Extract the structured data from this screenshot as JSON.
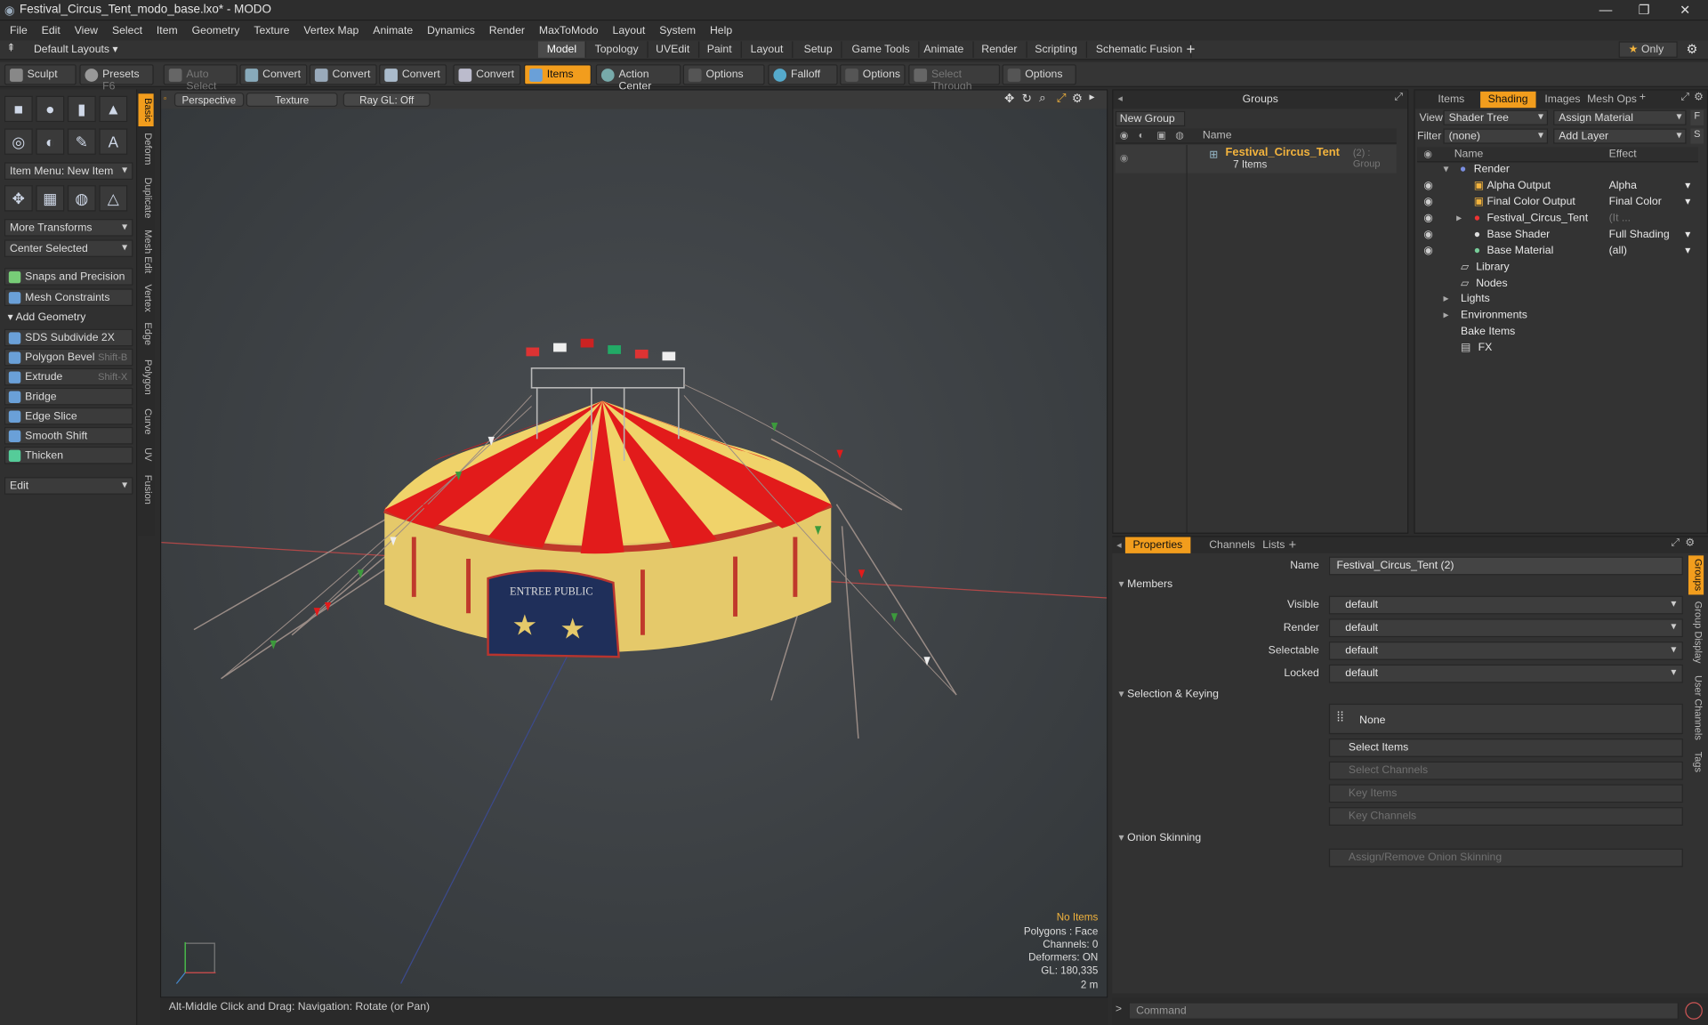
{
  "window": {
    "title": "Festival_Circus_Tent_modo_base.lxo* - MODO"
  },
  "menu": [
    "File",
    "Edit",
    "View",
    "Select",
    "Item",
    "Geometry",
    "Texture",
    "Vertex Map",
    "Animate",
    "Dynamics",
    "Render",
    "MaxToModo",
    "Layout",
    "System",
    "Help"
  ],
  "layouts": {
    "default": "Default Layouts",
    "tabs": [
      "Model",
      "Topology",
      "UVEdit",
      "Paint",
      "Layout",
      "Setup",
      "Game Tools",
      "Animate",
      "Render",
      "Scripting",
      "Schematic Fusion"
    ],
    "active": "Model",
    "only": "Only"
  },
  "toolbar": {
    "sculpt": "Sculpt",
    "presets": "Presets",
    "presets_key": "F6",
    "auto_select": "Auto Select",
    "convert": "Convert",
    "items": "Items",
    "action_center": "Action Center",
    "options": "Options",
    "falloff": "Falloff",
    "select_through": "Select Through"
  },
  "left": {
    "item_menu": "Item Menu: New Item",
    "more_transforms": "More Transforms",
    "center_selected": "Center Selected",
    "snaps": "Snaps and Precision",
    "mesh_constraints": "Mesh Constraints",
    "add_geometry": "Add Geometry",
    "tools": [
      {
        "label": "SDS Subdivide 2X",
        "key": ""
      },
      {
        "label": "Polygon Bevel",
        "key": "Shift-B"
      },
      {
        "label": "Extrude",
        "key": "Shift-X"
      },
      {
        "label": "Bridge",
        "key": ""
      },
      {
        "label": "Edge Slice",
        "key": ""
      },
      {
        "label": "Smooth Shift",
        "key": ""
      },
      {
        "label": "Thicken",
        "key": ""
      }
    ],
    "edit": "Edit",
    "vtabs": [
      "Basic",
      "Deform",
      "Duplicate",
      "Mesh Edit",
      "Vertex",
      "Edge",
      "Polygon",
      "Curve",
      "UV",
      "Fusion"
    ]
  },
  "viewport": {
    "perspective": "Perspective",
    "texture": "Texture",
    "raygl": "Ray GL: Off",
    "info": {
      "items": "No Items",
      "polygons": "Polygons : Face",
      "channels": "Channels: 0",
      "deformers": "Deformers: ON",
      "gl": "GL: 180,335",
      "scale": "2 m"
    },
    "status": "Alt-Middle Click and Drag:   Navigation: Rotate (or Pan)",
    "banner": "ENTREE PUBLIC"
  },
  "groups": {
    "title": "Groups",
    "new_group": "New Group",
    "col_name": "Name",
    "item_name": "Festival_Circus_Tent",
    "item_suffix": "(2) : Group",
    "item_count": "7 Items"
  },
  "shading": {
    "tabs": [
      "Items",
      "Shading",
      "Images",
      "Mesh Ops"
    ],
    "active": "Shading",
    "view_label": "View",
    "view_value": "Shader Tree",
    "assign": "Assign Material",
    "filter_label": "Filter",
    "filter_value": "(none)",
    "add_layer": "Add Layer",
    "col_name": "Name",
    "col_effect": "Effect",
    "rows": [
      {
        "name": "Render",
        "effect": ""
      },
      {
        "name": "Alpha Output",
        "effect": "Alpha"
      },
      {
        "name": "Final Color Output",
        "effect": "Final Color"
      },
      {
        "name": "Festival_Circus_Tent",
        "effect": "(It ..."
      },
      {
        "name": "Base Shader",
        "effect": "Full Shading"
      },
      {
        "name": "Base Material",
        "effect": "(all)"
      },
      {
        "name": "Library",
        "effect": ""
      },
      {
        "name": "Nodes",
        "effect": ""
      },
      {
        "name": "Lights",
        "effect": ""
      },
      {
        "name": "Environments",
        "effect": ""
      },
      {
        "name": "Bake Items",
        "effect": ""
      },
      {
        "name": "FX",
        "effect": ""
      }
    ]
  },
  "props": {
    "tabs": [
      "Properties",
      "Channels",
      "Lists"
    ],
    "name_label": "Name",
    "name_value": "Festival_Circus_Tent (2)",
    "members": "Members",
    "visible_label": "Visible",
    "visible": "default",
    "render_label": "Render",
    "render": "default",
    "selectable_label": "Selectable",
    "selectable": "default",
    "locked_label": "Locked",
    "locked": "default",
    "sel_keying": "Selection & Keying",
    "none": "None",
    "select_items": "Select Items",
    "select_channels": "Select Channels",
    "key_items": "Key Items",
    "key_channels": "Key Channels",
    "onion": "Onion Skinning",
    "assign_onion": "Assign/Remove Onion Skinning",
    "vtabs": [
      "Groups",
      "Group Display",
      "User Channels",
      "Tags"
    ]
  },
  "command": {
    "placeholder": "Command"
  },
  "colors": {
    "accent": "#f29d1d",
    "tent_red": "#e21b1b",
    "tent_yellow": "#f0d36a"
  }
}
